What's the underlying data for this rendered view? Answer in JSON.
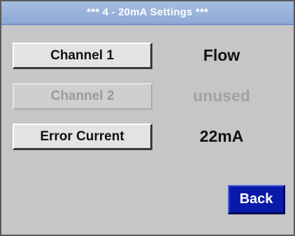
{
  "title": "***   4 - 20mA Settings  ***",
  "rows": [
    {
      "button_label": "Channel 1",
      "value": "Flow",
      "enabled": true
    },
    {
      "button_label": "Channel 2",
      "value": "unused",
      "enabled": false
    },
    {
      "button_label": "Error Current",
      "value": "22mA",
      "enabled": true
    }
  ],
  "back_label": "Back",
  "colors": {
    "title_bar": "#9bb4dd",
    "background": "#c6c6c6",
    "back_button": "#0a1aa8",
    "disabled_text": "#9a9a9a"
  }
}
